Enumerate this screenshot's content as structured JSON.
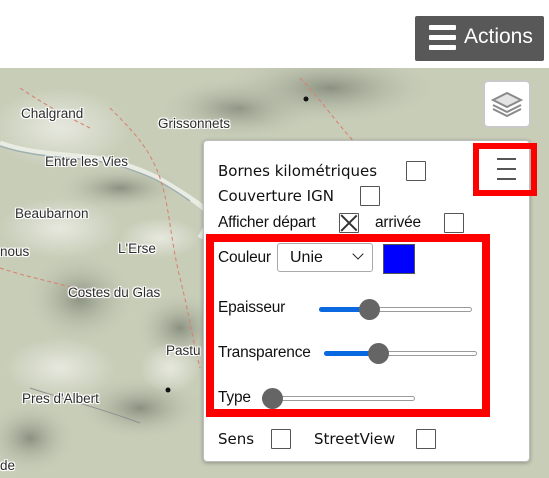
{
  "header": {
    "actions_label": "Actions"
  },
  "map": {
    "places": [
      "Chalgrand",
      "Grissonnets",
      "Entre les Vies",
      "Beaubarnon",
      "L'Erse",
      "Costes du Glas",
      "Pastu",
      "Pres d'Albert",
      "nous",
      "de"
    ]
  },
  "panel": {
    "bornes_label": "Bornes kilométriques",
    "couverture_label": "Couverture IGN",
    "afficher_depart_label": "Afficher départ",
    "arrivee_label": "arrivée",
    "couleur_label": "Couleur",
    "couleur_value": "Unie",
    "couleur_swatch": "#0000ff",
    "epaisseur_label": "Epaisseur",
    "epaisseur_level": 0.3,
    "transparence_label": "Transparence",
    "transparence_level": 0.33,
    "type_label": "Type",
    "type_level": 0.0,
    "sens_label": "Sens",
    "streetview_label": "StreetView",
    "checkboxes": {
      "bornes": false,
      "couverture": false,
      "depart": true,
      "arrivee": false,
      "sens": false,
      "streetview": false
    }
  },
  "colors": {
    "highlight": "#ff0000",
    "slider_fill": "#0a69e0",
    "actions_bg": "#585858"
  }
}
